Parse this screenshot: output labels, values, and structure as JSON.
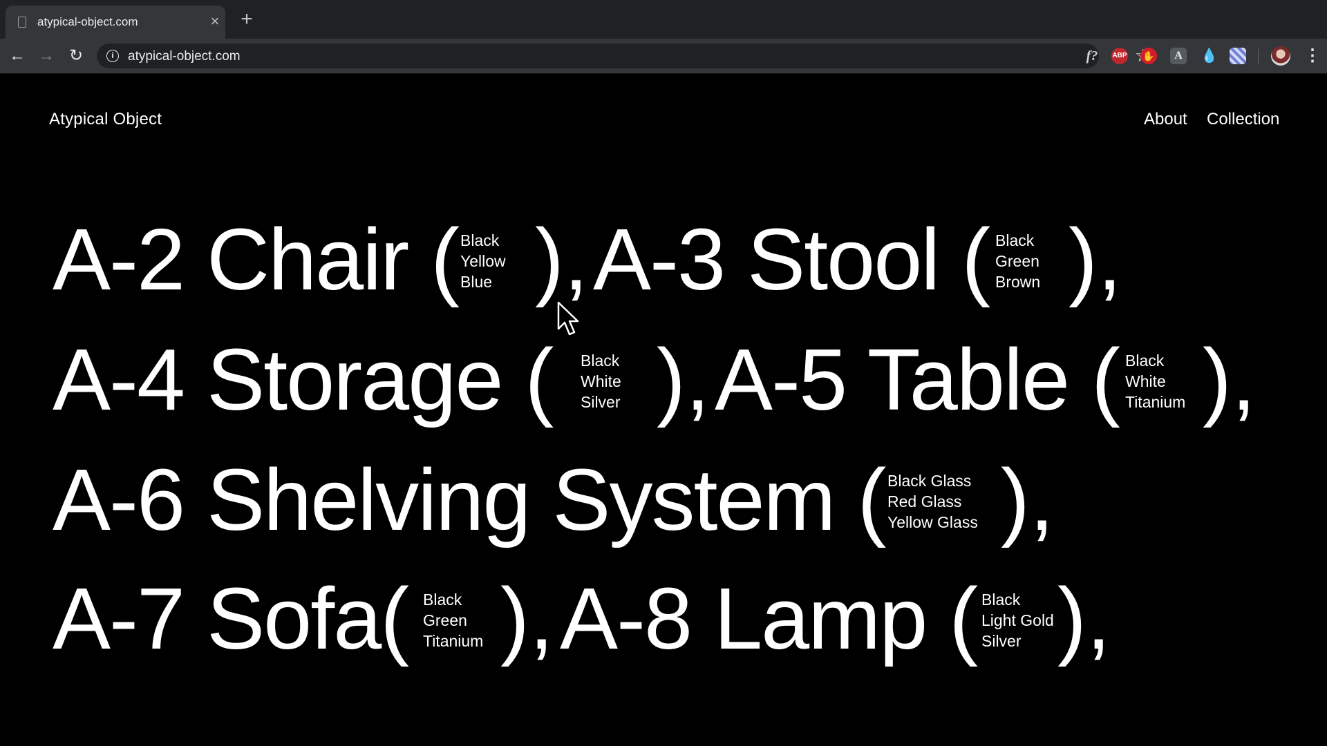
{
  "browser": {
    "tab_title": "atypical-object.com",
    "tab_close": "×",
    "new_tab": "+",
    "url": "atypical-object.com",
    "back": "←",
    "forward": "→",
    "reload": "↻",
    "info": "i",
    "star": "☆",
    "menu": "⋮",
    "extensions": {
      "fonts": "f?",
      "abp": "ABP",
      "stop": "✋",
      "a": "A",
      "drop": "💧"
    }
  },
  "site": {
    "logo": "Atypical Object",
    "nav": {
      "about": "About",
      "collection": "Collection"
    }
  },
  "items": [
    {
      "name": "A-2 Chair (",
      "close": "),",
      "variants": [
        "Black",
        "Yellow",
        "Blue"
      ]
    },
    {
      "name": "A-3 Stool (",
      "close": "),",
      "variants": [
        "Black",
        "Green",
        "Brown"
      ]
    },
    {
      "name": "A-4  Storage (",
      "close": "),",
      "variants": [
        "Black",
        "White",
        "Silver"
      ]
    },
    {
      "name": "A-5 Table (",
      "close": "),",
      "variants": [
        "Black",
        "White",
        "Titanium"
      ]
    },
    {
      "name": "A-6 Shelving System (",
      "close": "),",
      "variants": [
        "Black Glass",
        "Red Glass",
        "Yellow Glass"
      ]
    },
    {
      "name": "A-7  Sofa(",
      "close": "),",
      "variants": [
        "Black",
        "Green",
        "Titanium"
      ]
    },
    {
      "name": "A-8 Lamp (",
      "close": "),",
      "variants": [
        "Black",
        "Light Gold",
        "Silver"
      ]
    }
  ],
  "icons": {
    "cursor": "arrow-cursor-icon",
    "star": "star-icon",
    "reload": "reload-icon"
  },
  "colors": {
    "page_background": "#000000",
    "text": "#ffffff",
    "chrome_dark": "#202124",
    "chrome_toolbar": "#35363a"
  }
}
